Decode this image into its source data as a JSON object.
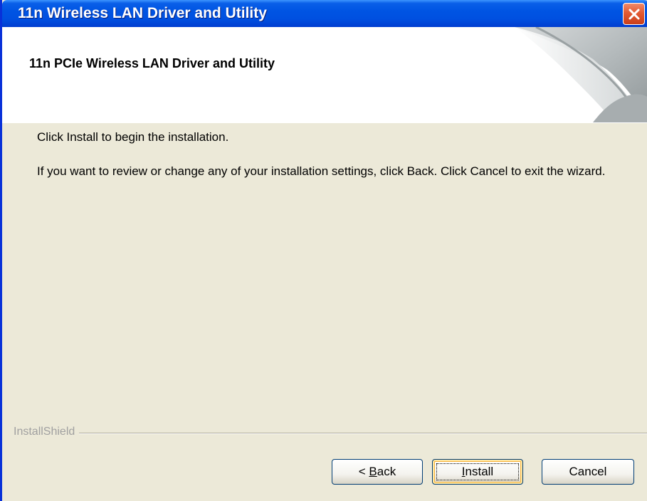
{
  "window": {
    "title": "11n Wireless LAN Driver and Utility",
    "title_color": "#ffffff",
    "titlebar_color": "#0054e3"
  },
  "header": {
    "title": "11n PCIe Wireless LAN Driver and Utility"
  },
  "body": {
    "line1": "Click Install to begin the installation.",
    "line2": "If you want to review or change any of your installation settings, click Back. Click Cancel to exit the wizard."
  },
  "footer": {
    "brand": "InstallShield"
  },
  "buttons": {
    "back_prefix": "< ",
    "back_mnemonic": "B",
    "back_rest": "ack",
    "install_mnemonic": "I",
    "install_rest": "nstall",
    "cancel": "Cancel"
  },
  "icons": {
    "close": "close-icon",
    "header_graphic": "page-curl-graphic"
  }
}
